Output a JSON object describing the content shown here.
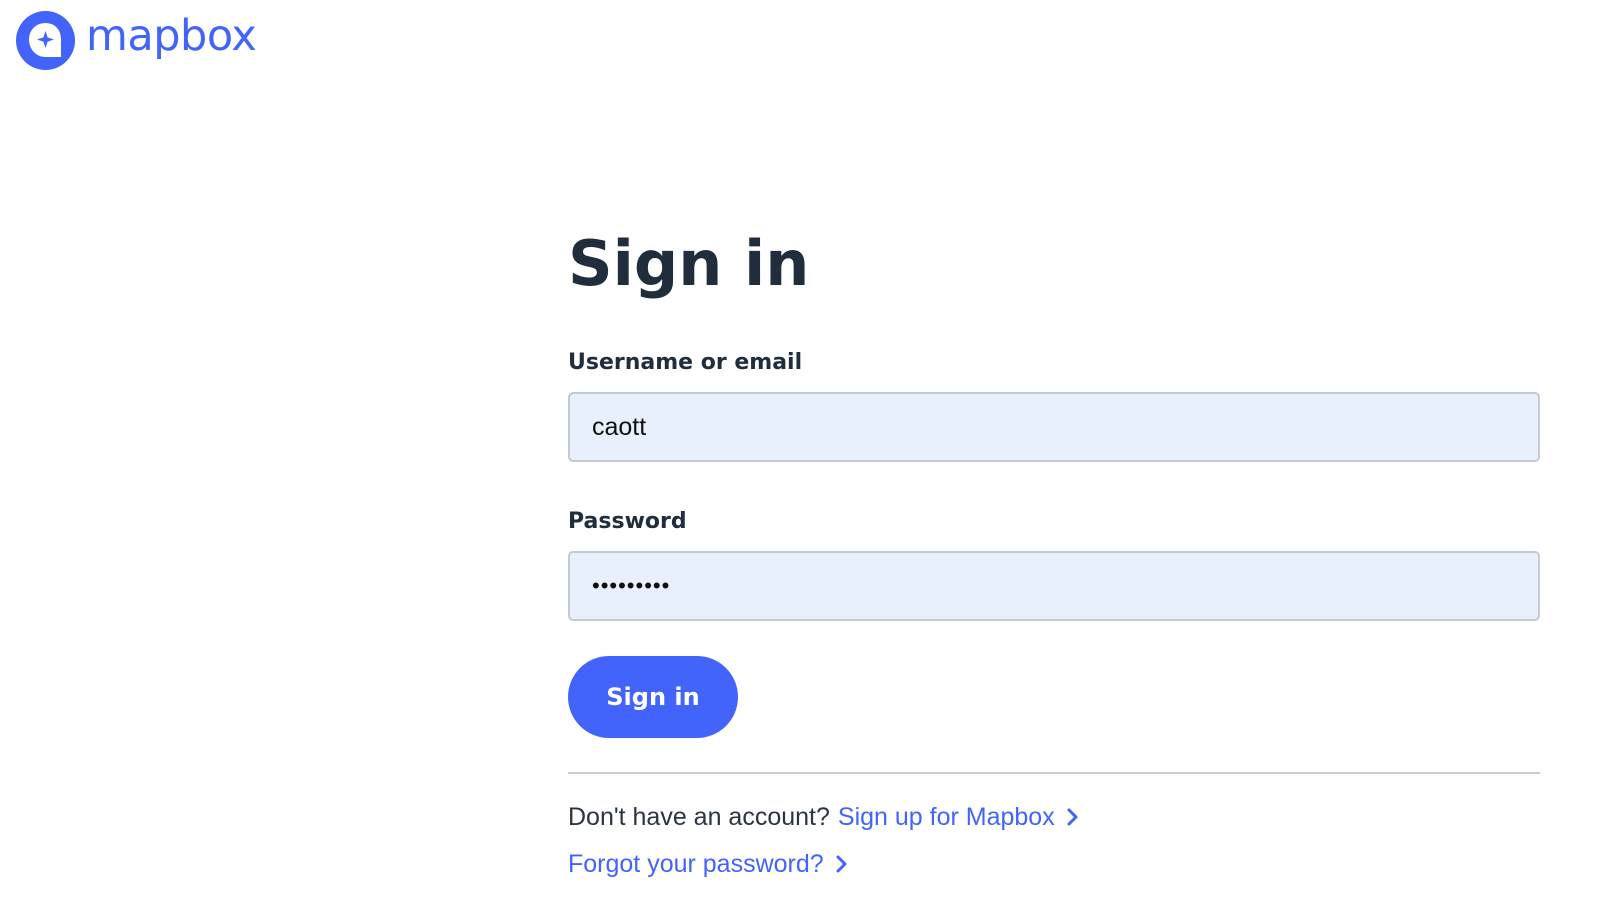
{
  "brand": {
    "name": "mapbox",
    "color": "#4264fb"
  },
  "form": {
    "title": "Sign in",
    "username": {
      "label": "Username or email",
      "value": "caott"
    },
    "password": {
      "label": "Password",
      "value": "•••••••••"
    },
    "submit_label": "Sign in"
  },
  "footer": {
    "signup_prompt": "Don't have an account?",
    "signup_link": "Sign up for Mapbox",
    "forgot_link": "Forgot your password?",
    "link_icon": "chevron-right-icon"
  },
  "colors": {
    "accent": "#4264fb",
    "text": "#1f2d3d",
    "input_bg": "#e8f0fe",
    "divider": "#c9ccd1"
  }
}
